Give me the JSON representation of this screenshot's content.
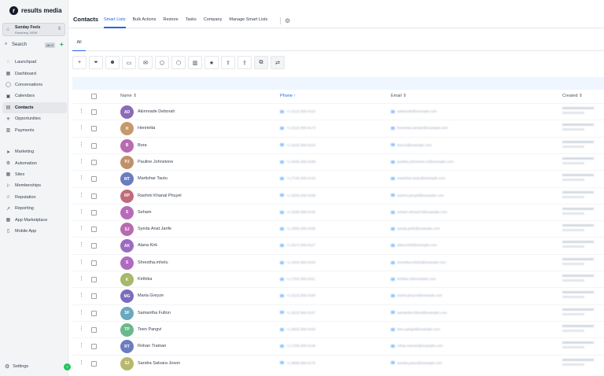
{
  "brand": {
    "name": "results media",
    "mark": "r"
  },
  "account": {
    "name": "Sunday Feels",
    "sub": "Rosebery, NSW"
  },
  "search": {
    "label": "Search",
    "shortcut": "ctrl K"
  },
  "nav_primary": [
    {
      "label": "Launchpad",
      "icon": "◌"
    },
    {
      "label": "Dashboard",
      "icon": "▦"
    },
    {
      "label": "Conversations",
      "icon": "◯"
    },
    {
      "label": "Calendars",
      "icon": "▣"
    },
    {
      "label": "Contacts",
      "icon": "▤",
      "active": true
    },
    {
      "label": "Opportunities",
      "icon": "✳"
    },
    {
      "label": "Payments",
      "icon": "▥"
    }
  ],
  "nav_secondary": [
    {
      "label": "Marketing",
      "icon": "➤"
    },
    {
      "label": "Automation",
      "icon": "⚙"
    },
    {
      "label": "Sites",
      "icon": "▦"
    },
    {
      "label": "Memberships",
      "icon": "⚐"
    },
    {
      "label": "Reputation",
      "icon": "☆"
    },
    {
      "label": "Reporting",
      "icon": "↗"
    },
    {
      "label": "App Marketplace",
      "icon": "▦"
    },
    {
      "label": "Mobile App",
      "icon": "▯"
    }
  ],
  "settings": {
    "label": "Settings"
  },
  "header": {
    "title": "Contacts",
    "tabs": [
      "Smart Lists",
      "Bulk Actions",
      "Restore",
      "Tasks",
      "Company",
      "Manage Smart Lists"
    ]
  },
  "subtab": "All",
  "toolbar_icons": [
    "plus-icon",
    "filter-icon",
    "robot-icon",
    "message-icon",
    "email-icon",
    "tag-add-icon",
    "tag-remove-icon",
    "delete-icon",
    "star-icon",
    "export-icon",
    "import-icon",
    "merge-icon",
    "shuffle-icon"
  ],
  "columns": {
    "name": "Name",
    "phone": "Phone",
    "email": "Email",
    "created": "Created"
  },
  "rows": [
    {
      "initials": "AD",
      "name": "Akinnrade Deborah",
      "color": "#8b6bb8",
      "phone": "+1 (212) 555-0110",
      "email": "adeborah@example.com"
    },
    {
      "initials": "H",
      "name": "Henrietta",
      "color": "#c49a6c",
      "phone": "+1 (312) 555-0173",
      "email": "henrietta.sample@example.com"
    },
    {
      "initials": "B",
      "name": "Bora",
      "color": "#b86bb0",
      "phone": "+1 (415) 555-0124",
      "email": "bora.k@example.com"
    },
    {
      "initials": "PJ",
      "name": "Pauline Johnstone",
      "color": "#c0906a",
      "phone": "+1 (646) 555-0189",
      "email": "pauline.johnstone.m@example.com"
    },
    {
      "initials": "MT",
      "name": "Martishar Tautu",
      "color": "#6b7cc0",
      "phone": "+1 (718) 555-0142",
      "email": "martishar.tautu@example.com"
    },
    {
      "initials": "RP",
      "name": "Rashmi Khanal Phuyel",
      "color": "#c06b7c",
      "phone": "+1 (503) 555-0168",
      "email": "rashmi.phuyel@example.com"
    },
    {
      "initials": "S",
      "name": "Seham",
      "color": "#b86bb8",
      "phone": "+1 (206) 555-0135",
      "email": "seham.ahmed.h@example.com"
    },
    {
      "initials": "SJ",
      "name": "Syeda Anat Janfe",
      "color": "#b86bb0",
      "phone": "+1 (305) 555-0156",
      "email": "syeda.janfe@example.com"
    },
    {
      "initials": "AK",
      "name": "Alana Kirk",
      "color": "#9a6bc0",
      "phone": "+1 (617) 555-0127",
      "email": "alana.kirk@example.com"
    },
    {
      "initials": "S",
      "name": "Shrestha.mhelu",
      "color": "#b06bc0",
      "phone": "+1 (404) 555-0193",
      "email": "shrestha.mhelu@example.com"
    },
    {
      "initials": "K",
      "name": "Kirthika",
      "color": "#a8b86b",
      "phone": "+1 (702) 555-0111",
      "email": "kirthika.s@example.com"
    },
    {
      "initials": "MG",
      "name": "Maria Greyze",
      "color": "#7b6bc0",
      "phone": "+1 (213) 555-0184",
      "email": "maria.greyze@example.com"
    },
    {
      "initials": "SF",
      "name": "Samantha Fulton",
      "color": "#6ba8c0",
      "phone": "+1 (512) 555-0137",
      "email": "samantha.fulton@example.com"
    },
    {
      "initials": "TP",
      "name": "Teen Pangvi",
      "color": "#6bb88b",
      "phone": "+1 (602) 555-0162",
      "email": "teen.pangvi@example.com"
    },
    {
      "initials": "RT",
      "name": "Rohan Traman",
      "color": "#6b7cc0",
      "phone": "+1 (720) 555-0148",
      "email": "rohan.traman@example.com"
    },
    {
      "initials": "SJ",
      "name": "Sandra Salvara Joson",
      "color": "#b8b86b",
      "phone": "+1 (808) 555-0175",
      "email": "sandra.joson@example.com"
    }
  ]
}
